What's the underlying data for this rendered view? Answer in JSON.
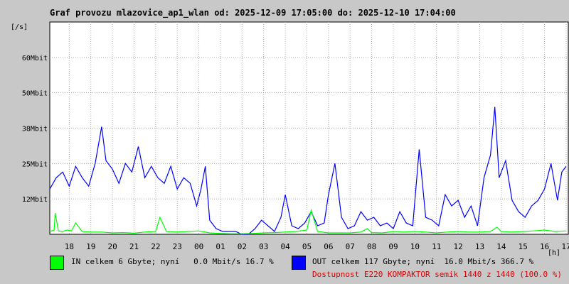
{
  "chart_data": {
    "type": "line",
    "title": "Graf provozu mlazovice_ap1_wlan od: 2025-12-09 17:05:00 do: 2025-12-10 17:04:00",
    "ylabel": "[/s]",
    "xlabel": "[h]",
    "y_tick_labels": [
      "12Mbit",
      "25Mbit",
      "38Mbit",
      "50Mbit",
      "60Mbit"
    ],
    "y_tick_values": [
      12.5,
      25,
      37.5,
      50,
      62.5
    ],
    "ylim": [
      0,
      75
    ],
    "x_tick_labels": [
      "18",
      "19",
      "20",
      "21",
      "22",
      "23",
      "00",
      "01",
      "02",
      "03",
      "04",
      "05",
      "06",
      "07",
      "08",
      "09",
      "10",
      "11",
      "12",
      "13",
      "14",
      "15",
      "16",
      "17"
    ],
    "xlim": [
      17.1,
      41.1
    ],
    "grid": true,
    "series": [
      {
        "name": "IN",
        "color": "#00ff00",
        "x": [
          17.1,
          17.3,
          17.35,
          17.5,
          17.7,
          17.9,
          18.1,
          18.3,
          18.6,
          19.0,
          19.5,
          20.0,
          20.5,
          21.0,
          21.5,
          22.0,
          22.2,
          22.5,
          23.0,
          23.5,
          24.0,
          24.5,
          25.0,
          25.5,
          26.0,
          26.5,
          27.0,
          27.5,
          28.0,
          28.5,
          29.0,
          29.2,
          29.5,
          30.0,
          30.5,
          31.0,
          31.5,
          31.8,
          32.0,
          32.5,
          33.0,
          33.5,
          34.0,
          34.5,
          35.0,
          35.5,
          36.0,
          36.5,
          37.0,
          37.5,
          37.8,
          38.0,
          38.5,
          39.0,
          39.5,
          40.0,
          40.5,
          41.0
        ],
        "values": [
          1.0,
          1.5,
          7.5,
          1.2,
          1.0,
          1.5,
          1.2,
          4.0,
          1.0,
          0.8,
          0.8,
          0.5,
          0.6,
          0.4,
          0.8,
          1.0,
          6.0,
          1.0,
          0.8,
          1.0,
          1.2,
          0.5,
          0.3,
          0.2,
          0.2,
          0.3,
          0.5,
          0.6,
          0.8,
          1.0,
          1.5,
          8.5,
          1.0,
          0.5,
          0.5,
          0.5,
          0.8,
          2.0,
          0.6,
          0.5,
          1.0,
          0.8,
          1.0,
          0.8,
          0.5,
          0.8,
          1.0,
          0.8,
          0.8,
          1.0,
          2.5,
          1.0,
          0.8,
          1.0,
          1.2,
          1.5,
          1.0,
          1.2
        ]
      },
      {
        "name": "OUT",
        "color": "#0000ff",
        "x": [
          17.1,
          17.4,
          17.7,
          18.0,
          18.3,
          18.6,
          18.9,
          19.2,
          19.5,
          19.7,
          20.0,
          20.3,
          20.6,
          20.9,
          21.2,
          21.5,
          21.8,
          22.1,
          22.4,
          22.7,
          23.0,
          23.3,
          23.6,
          23.9,
          24.1,
          24.3,
          24.5,
          24.8,
          25.1,
          25.4,
          25.7,
          26.0,
          26.3,
          26.6,
          26.9,
          27.2,
          27.5,
          27.8,
          28.0,
          28.3,
          28.6,
          28.9,
          29.2,
          29.5,
          29.8,
          30.0,
          30.3,
          30.6,
          30.9,
          31.2,
          31.5,
          31.8,
          32.1,
          32.4,
          32.7,
          33.0,
          33.3,
          33.6,
          33.9,
          34.2,
          34.5,
          34.8,
          35.1,
          35.4,
          35.7,
          36.0,
          36.3,
          36.6,
          36.9,
          37.2,
          37.5,
          37.7,
          37.9,
          38.2,
          38.5,
          38.8,
          39.1,
          39.4,
          39.7,
          40.0,
          40.3,
          40.6,
          40.8,
          41.0
        ],
        "values": [
          16,
          20,
          22,
          17,
          24,
          20,
          17,
          25,
          38,
          26,
          23,
          18,
          25,
          22,
          31,
          20,
          24,
          20,
          18,
          24,
          16,
          20,
          18,
          10,
          16,
          24,
          5,
          2,
          1,
          1,
          1,
          0,
          0,
          2,
          5,
          3,
          1,
          6,
          14,
          3,
          2,
          4,
          8,
          3,
          4,
          14,
          25,
          6,
          2,
          3,
          8,
          5,
          6,
          3,
          4,
          2,
          8,
          4,
          3,
          30,
          6,
          5,
          3,
          14,
          10,
          12,
          6,
          10,
          3,
          20,
          28,
          45,
          20,
          26,
          12,
          8,
          6,
          10,
          12,
          16,
          25,
          12,
          22,
          24
        ]
      }
    ],
    "legend": {
      "in_text": "IN celkem 6 Gbyte; nyní   0.0 Mbit/s 16.7 %",
      "out_text": "OUT celkem 117 Gbyte; nyní  16.0 Mbit/s 366.7 %",
      "avail_text": "Dostupnost E220 KOMPAKTOR semik 1440 z 1440 (100.0 %)",
      "avail_color": "#dd0000"
    }
  }
}
